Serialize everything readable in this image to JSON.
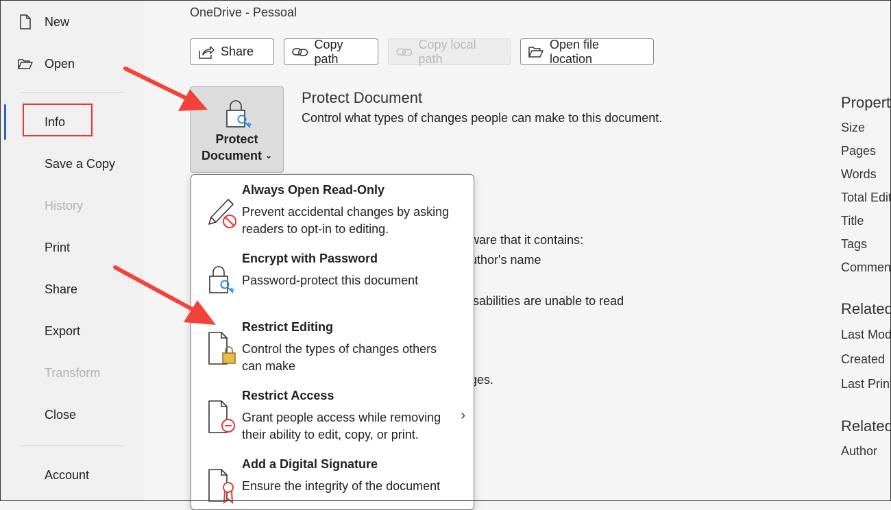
{
  "sidebar": {
    "items": [
      {
        "label": "New",
        "state": "normal"
      },
      {
        "label": "Open",
        "state": "normal"
      },
      {
        "label": "Info",
        "state": "active"
      },
      {
        "label": "Save a Copy",
        "state": "normal"
      },
      {
        "label": "History",
        "state": "disabled"
      },
      {
        "label": "Print",
        "state": "normal"
      },
      {
        "label": "Share",
        "state": "normal"
      },
      {
        "label": "Export",
        "state": "normal"
      },
      {
        "label": "Transform",
        "state": "disabled"
      },
      {
        "label": "Close",
        "state": "normal"
      },
      {
        "label": "Account",
        "state": "normal"
      }
    ]
  },
  "location": "OneDrive - Pessoal",
  "toolbar": {
    "share": "Share",
    "copy_path": "Copy path",
    "copy_local_path": "Copy local path",
    "open_file_location": "Open file location"
  },
  "protect": {
    "button_line1": "Protect",
    "button_line2": "Document",
    "title": "Protect Document",
    "description": "Control what types of changes people can make to this document."
  },
  "background_fragments": {
    "inspect_1": "ware that it contains:",
    "inspect_2": "uthor's name",
    "inspect_3": "isabilities are unable to read",
    "inspect_4": "ges."
  },
  "properties": {
    "heading": "Propert",
    "items": [
      "Size",
      "Pages",
      "Words",
      "Total Edit",
      "Title",
      "Tags",
      "Commen"
    ],
    "related_dates_heading": "Related",
    "related_dates": [
      "Last Mod",
      "Created",
      "Last Print"
    ],
    "related_people_heading": "Related",
    "related_people": [
      "Author"
    ]
  },
  "menu": {
    "items": [
      {
        "title": "Always Open Read-Only",
        "desc": "Prevent accidental changes by asking readers to opt-in to editing.",
        "icon": "pencil-prohibited-icon"
      },
      {
        "title": "Encrypt with Password",
        "desc": "Password-protect this document",
        "icon": "lock-key-icon"
      },
      {
        "title": "Restrict Editing",
        "desc": "Control the types of changes others can make",
        "icon": "document-lock-icon"
      },
      {
        "title": "Restrict Access",
        "desc": "Grant people access while removing their ability to edit, copy, or print.",
        "icon": "document-restricted-icon",
        "submenu": true
      },
      {
        "title": "Add a Digital Signature",
        "desc": "Ensure the integrity of the document",
        "icon": "document-ribbon-icon"
      }
    ]
  },
  "colors": {
    "accent": "#2f5fc6",
    "highlight_box": "#e53935",
    "annotation_arrow": "#f2433b",
    "key_blue": "#2f8fd8",
    "lock_gold": "#e9b949",
    "prohibit_red": "#e53935"
  }
}
